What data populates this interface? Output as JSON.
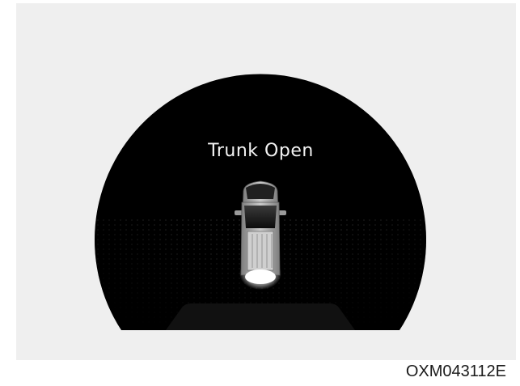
{
  "display": {
    "message": "Trunk Open",
    "vehicle_icon": "car-top-view-trunk-open-icon",
    "background_color": "#000000",
    "panel_color": "#efefef"
  },
  "figure": {
    "code": "OXM043112E"
  }
}
